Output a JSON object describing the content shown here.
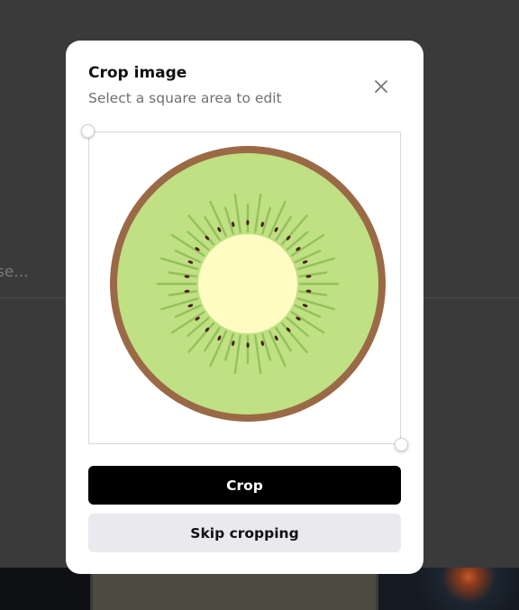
{
  "background": {
    "search_text_fragment": "se..."
  },
  "modal": {
    "title": "Crop image",
    "subtitle": "Select a square area to edit",
    "close_icon": "close-icon",
    "crop_image_subject": "kiwi-slice-illustration",
    "crop_button_label": "Crop",
    "skip_button_label": "Skip cropping"
  },
  "colors": {
    "overlay_background": "#3a3a3a",
    "modal_background": "#ffffff",
    "primary_button": "#000000",
    "secondary_button": "#e9e9ee",
    "kiwi_skin": "#9a6a47",
    "kiwi_flesh": "#bfe083",
    "kiwi_core": "#fffbc2",
    "kiwi_seed": "#4a1f1a"
  }
}
